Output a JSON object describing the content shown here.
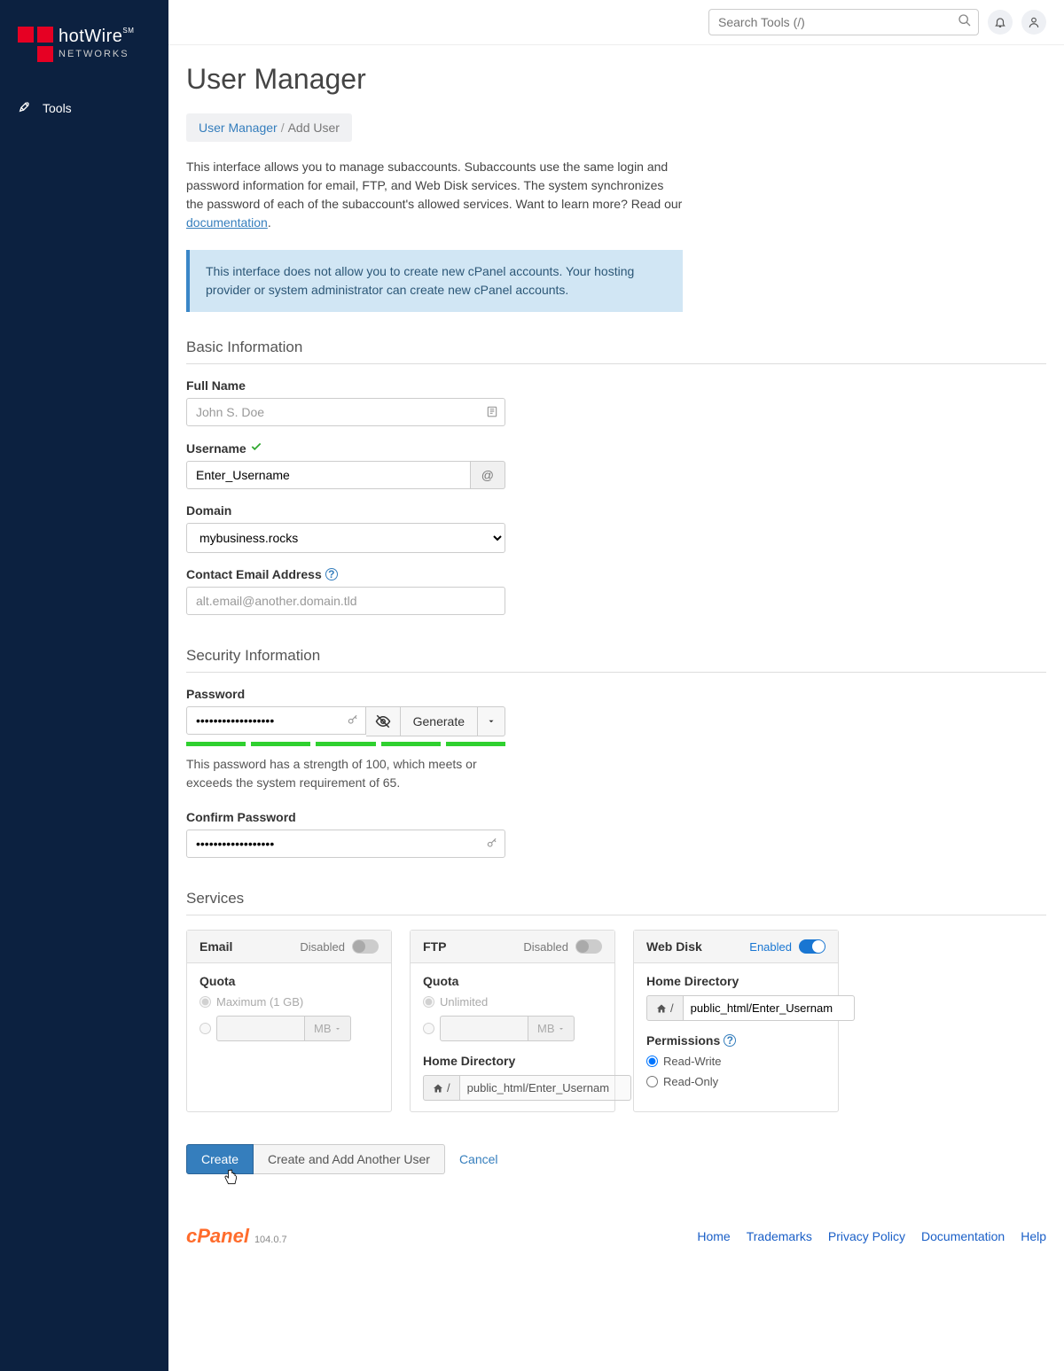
{
  "brand": {
    "name": "hotWire",
    "sub": "NETWORKS",
    "sm": "SM"
  },
  "nav": {
    "tools": "Tools"
  },
  "topbar": {
    "search_placeholder": "Search Tools (/)"
  },
  "page": {
    "title": "User Manager"
  },
  "breadcrumb": {
    "link": "User Manager",
    "sep": "/",
    "current": "Add User"
  },
  "intro": {
    "text": "This interface allows you to manage subaccounts. Subaccounts use the same login and password information for email, FTP, and Web Disk services. The system synchronizes the password of each of the subaccount's allowed services. Want to learn more? Read our ",
    "link": "documentation"
  },
  "info": {
    "text": "This interface does not allow you to create new cPanel accounts. Your hosting provider or system administrator can create new cPanel accounts."
  },
  "sections": {
    "basic": "Basic Information",
    "security": "Security Information",
    "services": "Services"
  },
  "form": {
    "full_name_label": "Full Name",
    "full_name_placeholder": "John S. Doe",
    "username_label": "Username",
    "username_value": "Enter_Username",
    "domain_label": "Domain",
    "domain_value": "mybusiness.rocks",
    "contact_label": "Contact Email Address",
    "contact_placeholder": "alt.email@another.domain.tld",
    "password_label": "Password",
    "password_value": "••••••••••••••••••",
    "generate_label": "Generate",
    "strength_text": "This password has a strength of 100, which meets or exceeds the system requirement of 65.",
    "confirm_label": "Confirm Password",
    "confirm_value": "••••••••••••••••••"
  },
  "services": {
    "email": {
      "title": "Email",
      "status": "Disabled",
      "quota_label": "Quota",
      "max_label": "Maximum (1 GB)",
      "unit": "MB"
    },
    "ftp": {
      "title": "FTP",
      "status": "Disabled",
      "quota_label": "Quota",
      "unlimited_label": "Unlimited",
      "unit": "MB",
      "home_label": "Home Directory",
      "home_prefix": "/",
      "home_value": "public_html/Enter_Usernam"
    },
    "webdisk": {
      "title": "Web Disk",
      "status": "Enabled",
      "home_label": "Home Directory",
      "home_prefix": "/",
      "home_value": "public_html/Enter_Usernam",
      "perms_label": "Permissions",
      "rw": "Read-Write",
      "ro": "Read-Only"
    }
  },
  "actions": {
    "create": "Create",
    "create_another": "Create and Add Another User",
    "cancel": "Cancel"
  },
  "footer": {
    "cpanel": "cPanel",
    "version": "104.0.7",
    "links": [
      "Home",
      "Trademarks",
      "Privacy Policy",
      "Documentation",
      "Help"
    ]
  }
}
